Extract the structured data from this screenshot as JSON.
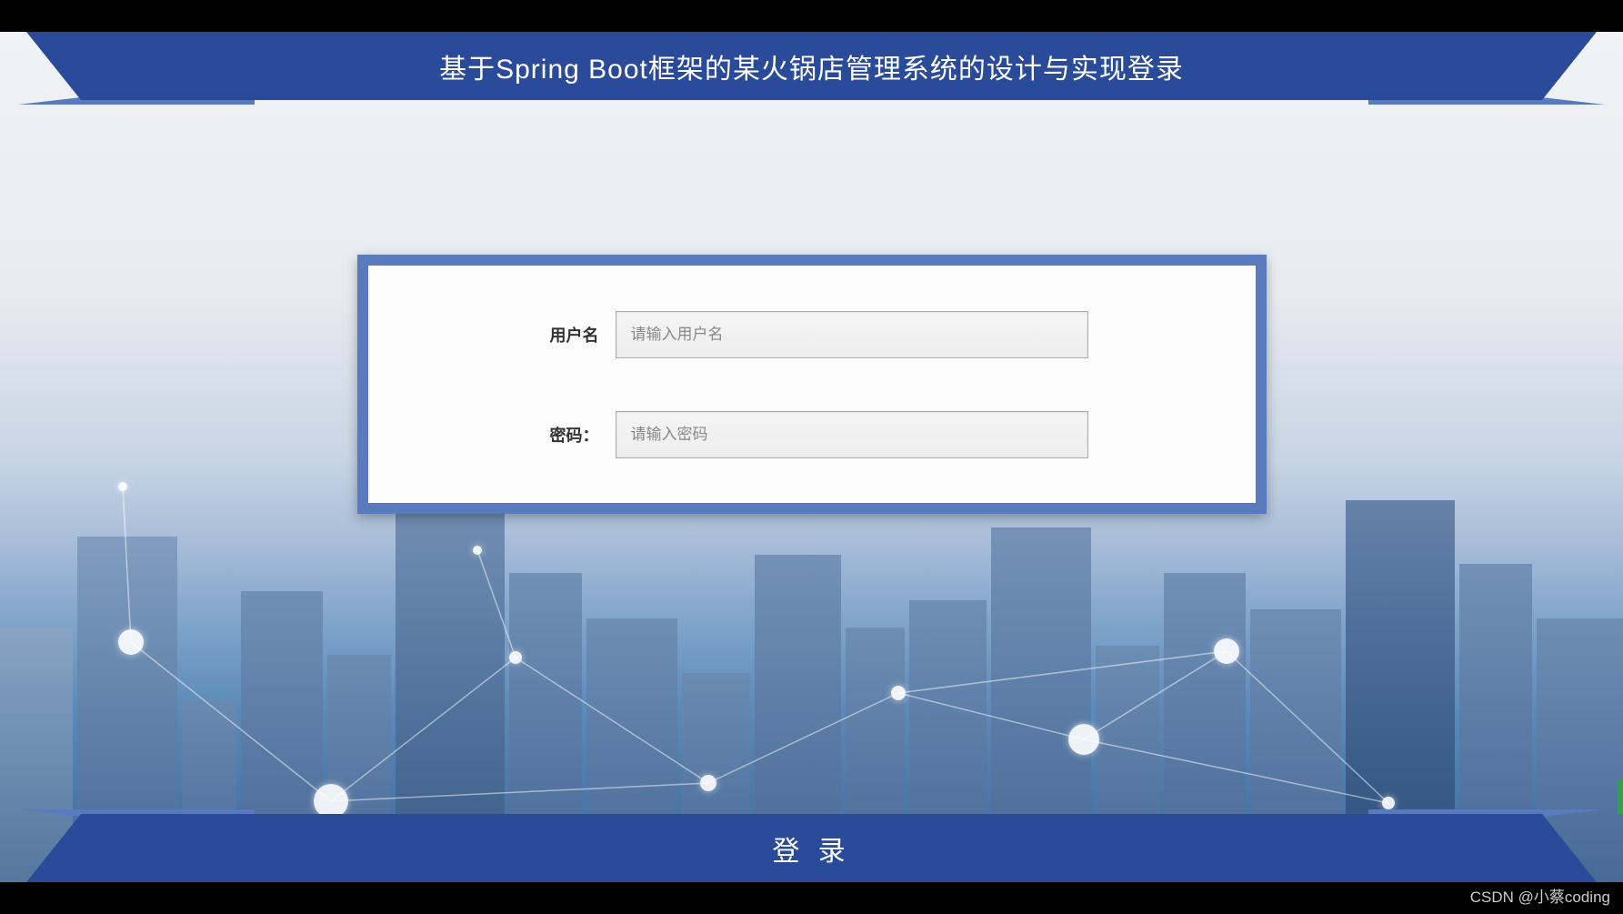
{
  "header": {
    "title": "基于Spring Boot框架的某火锅店管理系统的设计与实现登录"
  },
  "form": {
    "username": {
      "label": "用户名",
      "placeholder": "请输入用户名",
      "value": ""
    },
    "password": {
      "label": "密码：",
      "placeholder": "请输入密码",
      "value": ""
    }
  },
  "footer": {
    "login_button": "登 录"
  },
  "watermark": "CSDN @小蔡coding"
}
